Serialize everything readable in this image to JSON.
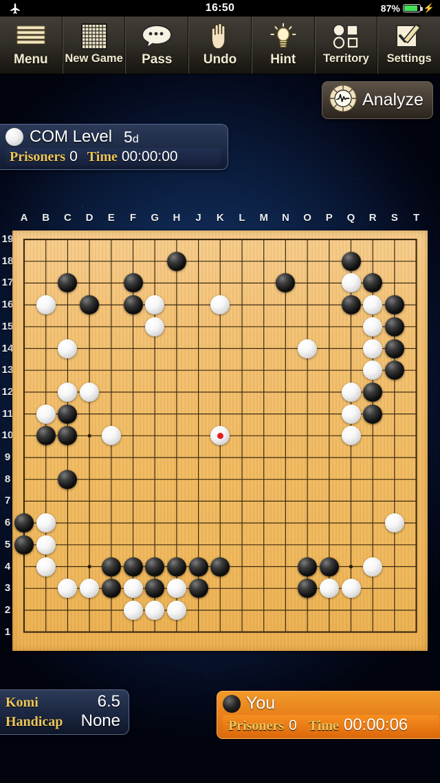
{
  "status_bar": {
    "airplane_icon": "airplane-icon",
    "clock": "16:50",
    "battery_pct": "87%",
    "battery_level": 87,
    "charging_icon": "lightning-bolt-icon"
  },
  "toolbar": {
    "buttons": [
      {
        "label": "Menu",
        "icon": "hamburger-menu-icon"
      },
      {
        "label": "New Game",
        "icon": "go-board-grid-icon"
      },
      {
        "label": "Pass",
        "icon": "speech-bubble-icon"
      },
      {
        "label": "Undo",
        "icon": "hand-icon"
      },
      {
        "label": "Hint",
        "icon": "lightbulb-icon"
      },
      {
        "label": "Territory",
        "icon": "territory-shapes-icon"
      },
      {
        "label": "Settings",
        "icon": "checklist-pencil-icon"
      }
    ]
  },
  "analyze_button": {
    "label": "Analyze",
    "icon": "analyze-waveform-icon"
  },
  "com_panel": {
    "stone_icon": "white-stone-icon",
    "name": "COM Level",
    "level": "5",
    "level_suffix": "d",
    "prisoners_label": "Prisoners",
    "prisoners_value": "0",
    "time_label": "Time",
    "time_value": "00:00:00"
  },
  "you_panel": {
    "stone_icon": "black-stone-icon",
    "name": "You",
    "prisoners_label": "Prisoners",
    "prisoners_value": "0",
    "time_label": "Time",
    "time_value": "00:00:06"
  },
  "game_info": {
    "komi_label": "Komi",
    "komi_value": "6.5",
    "handicap_label": "Handicap",
    "handicap_value": "None"
  },
  "board": {
    "size": 19,
    "columns": [
      "A",
      "B",
      "C",
      "D",
      "E",
      "F",
      "G",
      "H",
      "J",
      "K",
      "L",
      "M",
      "N",
      "O",
      "P",
      "Q",
      "R",
      "S",
      "T"
    ],
    "rows": [
      "19",
      "18",
      "17",
      "16",
      "15",
      "14",
      "13",
      "12",
      "11",
      "10",
      "9",
      "8",
      "7",
      "6",
      "5",
      "4",
      "3",
      "2",
      "1"
    ],
    "star_points": [
      "D16",
      "K16",
      "Q16",
      "D10",
      "K10",
      "Q10",
      "D4",
      "K4",
      "Q4"
    ],
    "last_move": "K10",
    "stones": [
      {
        "pos": "H18",
        "color": "b"
      },
      {
        "pos": "Q18",
        "color": "b"
      },
      {
        "pos": "C17",
        "color": "b"
      },
      {
        "pos": "F17",
        "color": "b"
      },
      {
        "pos": "N17",
        "color": "b"
      },
      {
        "pos": "Q17",
        "color": "w"
      },
      {
        "pos": "R17",
        "color": "b"
      },
      {
        "pos": "B16",
        "color": "w"
      },
      {
        "pos": "D16",
        "color": "b"
      },
      {
        "pos": "F16",
        "color": "b"
      },
      {
        "pos": "G16",
        "color": "w"
      },
      {
        "pos": "K16",
        "color": "w"
      },
      {
        "pos": "Q16",
        "color": "b"
      },
      {
        "pos": "R16",
        "color": "w"
      },
      {
        "pos": "S16",
        "color": "b"
      },
      {
        "pos": "G15",
        "color": "w"
      },
      {
        "pos": "R15",
        "color": "w"
      },
      {
        "pos": "S15",
        "color": "b"
      },
      {
        "pos": "C14",
        "color": "w"
      },
      {
        "pos": "O14",
        "color": "w"
      },
      {
        "pos": "R14",
        "color": "w"
      },
      {
        "pos": "S14",
        "color": "b"
      },
      {
        "pos": "R13",
        "color": "w"
      },
      {
        "pos": "S13",
        "color": "b"
      },
      {
        "pos": "C12",
        "color": "w"
      },
      {
        "pos": "D12",
        "color": "w"
      },
      {
        "pos": "Q12",
        "color": "w"
      },
      {
        "pos": "R12",
        "color": "b"
      },
      {
        "pos": "B11",
        "color": "w"
      },
      {
        "pos": "C11",
        "color": "b"
      },
      {
        "pos": "Q11",
        "color": "w"
      },
      {
        "pos": "R11",
        "color": "b"
      },
      {
        "pos": "B10",
        "color": "b"
      },
      {
        "pos": "C10",
        "color": "b"
      },
      {
        "pos": "E10",
        "color": "w"
      },
      {
        "pos": "K10",
        "color": "w",
        "marked": true
      },
      {
        "pos": "Q10",
        "color": "w"
      },
      {
        "pos": "C8",
        "color": "b"
      },
      {
        "pos": "A6",
        "color": "b"
      },
      {
        "pos": "B6",
        "color": "w"
      },
      {
        "pos": "S6",
        "color": "w"
      },
      {
        "pos": "A5",
        "color": "b"
      },
      {
        "pos": "B5",
        "color": "w"
      },
      {
        "pos": "B4",
        "color": "w"
      },
      {
        "pos": "E4",
        "color": "b"
      },
      {
        "pos": "F4",
        "color": "b"
      },
      {
        "pos": "G4",
        "color": "b"
      },
      {
        "pos": "H4",
        "color": "b"
      },
      {
        "pos": "J4",
        "color": "b"
      },
      {
        "pos": "K4",
        "color": "b"
      },
      {
        "pos": "O4",
        "color": "b"
      },
      {
        "pos": "P4",
        "color": "b"
      },
      {
        "pos": "R4",
        "color": "w"
      },
      {
        "pos": "C3",
        "color": "w"
      },
      {
        "pos": "D3",
        "color": "w"
      },
      {
        "pos": "E3",
        "color": "b"
      },
      {
        "pos": "F3",
        "color": "w"
      },
      {
        "pos": "G3",
        "color": "b"
      },
      {
        "pos": "H3",
        "color": "w"
      },
      {
        "pos": "J3",
        "color": "b"
      },
      {
        "pos": "O3",
        "color": "b"
      },
      {
        "pos": "P3",
        "color": "w"
      },
      {
        "pos": "Q3",
        "color": "w"
      },
      {
        "pos": "F2",
        "color": "w"
      },
      {
        "pos": "G2",
        "color": "w"
      },
      {
        "pos": "H2",
        "color": "w"
      }
    ]
  }
}
